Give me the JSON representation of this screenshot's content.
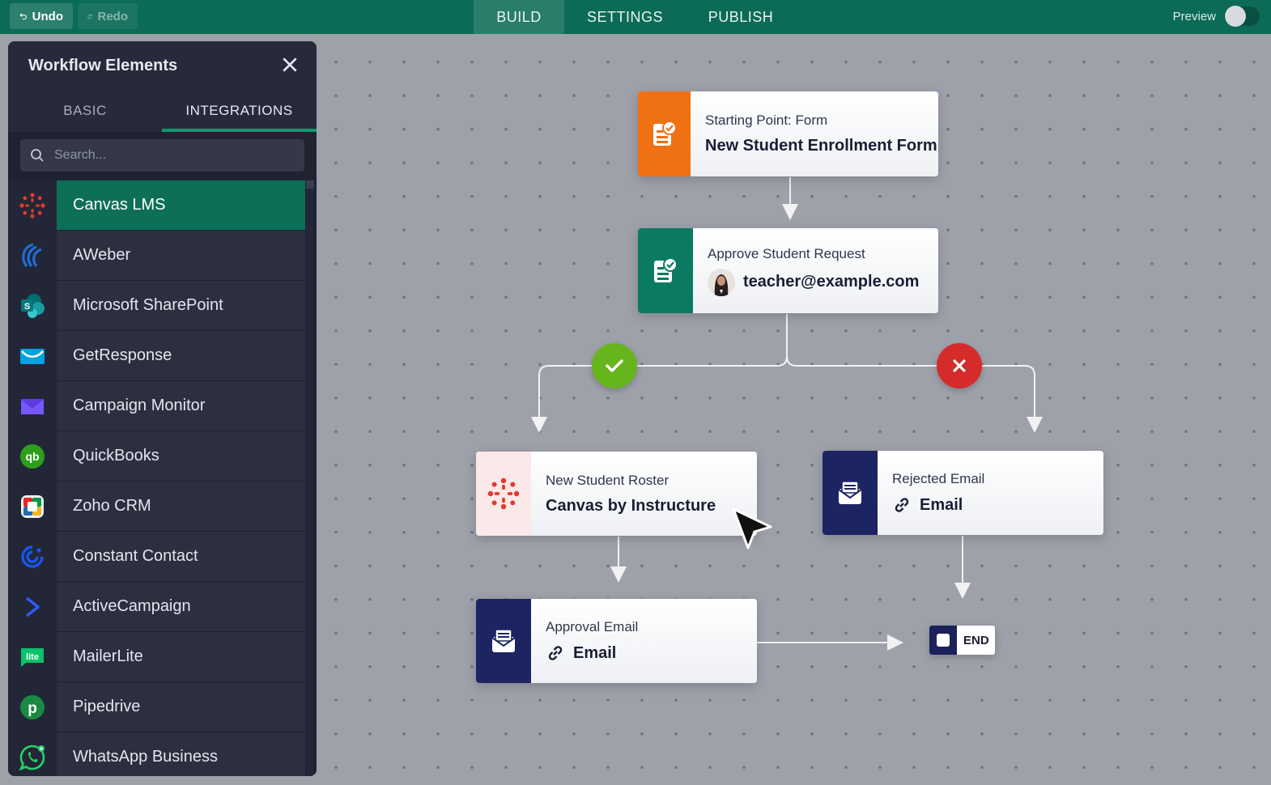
{
  "topbar": {
    "undo_label": "Undo",
    "redo_label": "Redo",
    "tabs": [
      {
        "label": "BUILD",
        "active": true
      },
      {
        "label": "SETTINGS",
        "active": false
      },
      {
        "label": "PUBLISH",
        "active": false
      }
    ],
    "preview_label": "Preview",
    "preview_on": false
  },
  "sidebar": {
    "title": "Workflow Elements",
    "tabs": [
      {
        "label": "BASIC",
        "active": false
      },
      {
        "label": "INTEGRATIONS",
        "active": true
      }
    ],
    "search_placeholder": "Search...",
    "items": [
      {
        "label": "Canvas LMS",
        "icon": "canvas-lms-icon",
        "active": true
      },
      {
        "label": "AWeber",
        "icon": "aweber-icon"
      },
      {
        "label": "Microsoft SharePoint",
        "icon": "sharepoint-icon"
      },
      {
        "label": "GetResponse",
        "icon": "getresponse-icon"
      },
      {
        "label": "Campaign Monitor",
        "icon": "campaign-monitor-icon"
      },
      {
        "label": "QuickBooks",
        "icon": "quickbooks-icon"
      },
      {
        "label": "Zoho CRM",
        "icon": "zoho-crm-icon"
      },
      {
        "label": "Constant Contact",
        "icon": "constant-contact-icon"
      },
      {
        "label": "ActiveCampaign",
        "icon": "activecampaign-icon"
      },
      {
        "label": "MailerLite",
        "icon": "mailerlite-icon"
      },
      {
        "label": "Pipedrive",
        "icon": "pipedrive-icon"
      },
      {
        "label": "WhatsApp Business",
        "icon": "whatsapp-icon"
      }
    ]
  },
  "workflow": {
    "start": {
      "subtitle": "Starting Point: Form",
      "title": "New Student Enrollment Form",
      "color": "#f07014"
    },
    "approval": {
      "subtitle": "Approve Student Request",
      "title": "teacher@example.com",
      "color": "#0b7a63"
    },
    "roster": {
      "subtitle": "New Student Roster",
      "title": "Canvas by Instructure"
    },
    "rejected": {
      "subtitle": "Rejected Email",
      "title": "Email",
      "color": "#1c2462"
    },
    "approval_email": {
      "subtitle": "Approval Email",
      "title": "Email",
      "color": "#1c2462"
    },
    "end_label": "END"
  },
  "colors": {
    "topbar": "#0b6b57",
    "approve": "#67b51c",
    "reject": "#d52b2b"
  }
}
